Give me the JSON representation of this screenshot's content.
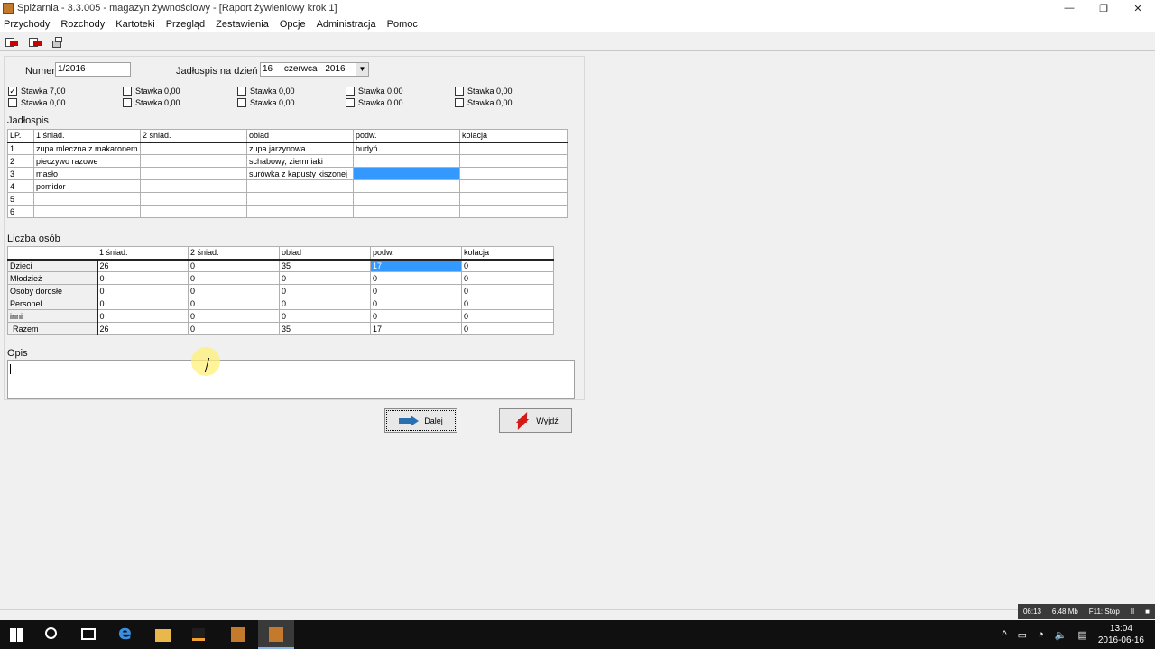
{
  "window": {
    "title": "Spiżarnia - 3.3.005 - magazyn żywnościowy - [Raport żywieniowy krok 1]",
    "minimize": "—",
    "restore": "❐",
    "close": "✕"
  },
  "menu": [
    "Przychody",
    "Rozchody",
    "Kartoteki",
    "Przegląd",
    "Zestawienia",
    "Opcje",
    "Administracja",
    "Pomoc"
  ],
  "form": {
    "numer_label": "Numer",
    "numer_value": "1/2016",
    "date_label": "Jadłospis na dzień",
    "date_day": "16",
    "date_month": "czerwca",
    "date_year": "2016"
  },
  "stawki": [
    [
      "Stawka 7,00",
      "Stawka 0,00",
      "Stawka 0,00",
      "Stawka 0,00",
      "Stawka 0,00"
    ],
    [
      "Stawka 0,00",
      "Stawka 0,00",
      "Stawka 0,00",
      "Stawka 0,00",
      "Stawka 0,00"
    ]
  ],
  "jadlospis": {
    "title": "Jadłospis",
    "headers": [
      "LP.",
      "1 śniad.",
      "2 śniad.",
      "obiad",
      "podw.",
      "kolacja"
    ],
    "rows": [
      [
        "1",
        "zupa mleczna z makaronem",
        "",
        "zupa jarzynowa",
        "budyń",
        ""
      ],
      [
        "2",
        "pieczywo razowe",
        "",
        "schabowy, ziemniaki",
        "",
        ""
      ],
      [
        "3",
        "masło",
        "",
        "surówka z kapusty kiszonej",
        "",
        ""
      ],
      [
        "4",
        "pomidor",
        "",
        "",
        "",
        ""
      ],
      [
        "5",
        "",
        "",
        "",
        "",
        ""
      ],
      [
        "6",
        "",
        "",
        "",
        "",
        ""
      ]
    ]
  },
  "liczba_osob": {
    "title": "Liczba osób",
    "headers": [
      "",
      "1 śniad.",
      "2 śniad.",
      "obiad",
      "podw.",
      "kolacja"
    ],
    "rows": [
      [
        "Dzieci",
        "26",
        "0",
        "35",
        "17",
        "0"
      ],
      [
        "Młodzież",
        "0",
        "0",
        "0",
        "0",
        "0"
      ],
      [
        "Osoby dorosłe",
        "0",
        "0",
        "0",
        "0",
        "0"
      ],
      [
        "Personel",
        "0",
        "0",
        "0",
        "0",
        "0"
      ],
      [
        "inni",
        "0",
        "0",
        "0",
        "0",
        "0"
      ],
      [
        "Razem",
        "26",
        "0",
        "35",
        "17",
        "0"
      ]
    ]
  },
  "opis": {
    "title": "Opis",
    "value": ""
  },
  "buttons": {
    "next": "Dalej",
    "exit": "Wyjdź"
  },
  "recorder": {
    "time": "06:13",
    "size": "6.48 Mb",
    "hotkey": "F11: Stop",
    "pause": "II",
    "stop": "■"
  },
  "taskbar": {
    "time": "13:04",
    "date": "2016-06-16",
    "edge_glyph": "e",
    "tray_chevron": "^",
    "tray_battery": "▭",
    "tray_net": "◔",
    "tray_volume": "🔈",
    "tray_notify": "▤"
  }
}
